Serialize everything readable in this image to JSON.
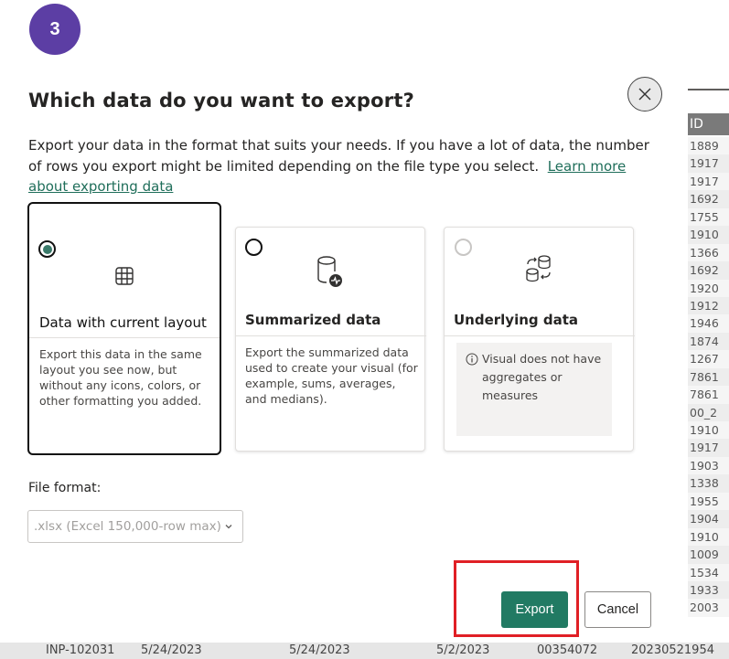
{
  "step_badge": "3",
  "dialog": {
    "title": "Which data do you want to export?",
    "description": "Export your data in the format that suits your needs. If you have a lot of data, the number of rows you export might be limited depending on the file type you select.",
    "learn_more_link": "Learn more about exporting data",
    "close_icon": "close-icon"
  },
  "options": [
    {
      "id": "current-layout",
      "title": "Data with current layout",
      "description": "Export this data in the same layout you see now, but without any icons, colors, or other formatting you added.",
      "selected": true,
      "icon": "table-icon"
    },
    {
      "id": "summarized",
      "title": "Summarized data",
      "description": "Export the summarized data used to create your visual (for example, sums, averages, and medians).",
      "selected": false,
      "icon": "database-pulse-icon"
    },
    {
      "id": "underlying",
      "title": "Underlying data",
      "description": "Visual does not have aggregates or measures",
      "selected": false,
      "disabled": true,
      "icon": "database-transfer-icon",
      "info_icon": "info-icon"
    }
  ],
  "file_format": {
    "label": "File format:",
    "value": ".xlsx (Excel 150,000-row max)"
  },
  "buttons": {
    "export": "Export",
    "cancel": "Cancel"
  },
  "colors": {
    "accent": "#217a63",
    "badge": "#5c3ea4",
    "annotation_red": "#e01f25",
    "highlight_yellow": "#f7ef00"
  },
  "background_table": {
    "id_header": "ID",
    "id_cells": [
      "1889",
      "1917",
      "1917",
      "1692",
      "1755",
      "1910",
      "1366",
      "1692",
      "1920",
      "1912",
      "1946",
      "1874",
      "1267",
      "7861",
      "7861",
      "00_2",
      "1910",
      "1917",
      "1903",
      "1338",
      "1955",
      "1904",
      "1910",
      "1009",
      "1534",
      "1933",
      "2003"
    ],
    "bottom_row": [
      "INP-102031",
      "5/24/2023",
      "5/24/2023",
      "5/2/2023",
      "00354072",
      "20230521954"
    ]
  }
}
